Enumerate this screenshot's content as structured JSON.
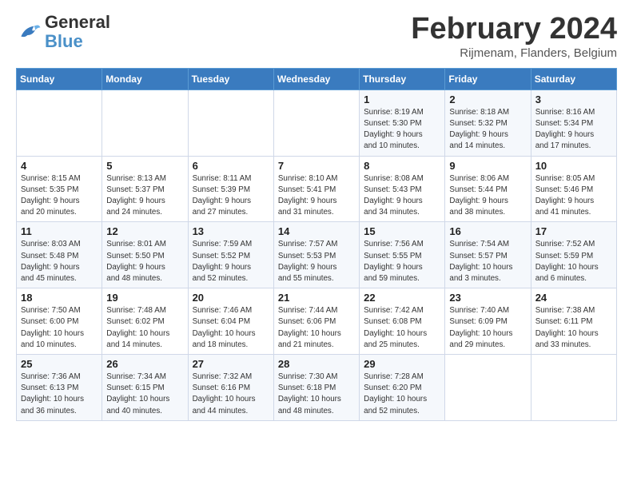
{
  "logo": {
    "line1": "General",
    "line2": "Blue"
  },
  "title": "February 2024",
  "subtitle": "Rijmenam, Flanders, Belgium",
  "days_header": [
    "Sunday",
    "Monday",
    "Tuesday",
    "Wednesday",
    "Thursday",
    "Friday",
    "Saturday"
  ],
  "weeks": [
    [
      {
        "day": "",
        "info": ""
      },
      {
        "day": "",
        "info": ""
      },
      {
        "day": "",
        "info": ""
      },
      {
        "day": "",
        "info": ""
      },
      {
        "day": "1",
        "info": "Sunrise: 8:19 AM\nSunset: 5:30 PM\nDaylight: 9 hours\nand 10 minutes."
      },
      {
        "day": "2",
        "info": "Sunrise: 8:18 AM\nSunset: 5:32 PM\nDaylight: 9 hours\nand 14 minutes."
      },
      {
        "day": "3",
        "info": "Sunrise: 8:16 AM\nSunset: 5:34 PM\nDaylight: 9 hours\nand 17 minutes."
      }
    ],
    [
      {
        "day": "4",
        "info": "Sunrise: 8:15 AM\nSunset: 5:35 PM\nDaylight: 9 hours\nand 20 minutes."
      },
      {
        "day": "5",
        "info": "Sunrise: 8:13 AM\nSunset: 5:37 PM\nDaylight: 9 hours\nand 24 minutes."
      },
      {
        "day": "6",
        "info": "Sunrise: 8:11 AM\nSunset: 5:39 PM\nDaylight: 9 hours\nand 27 minutes."
      },
      {
        "day": "7",
        "info": "Sunrise: 8:10 AM\nSunset: 5:41 PM\nDaylight: 9 hours\nand 31 minutes."
      },
      {
        "day": "8",
        "info": "Sunrise: 8:08 AM\nSunset: 5:43 PM\nDaylight: 9 hours\nand 34 minutes."
      },
      {
        "day": "9",
        "info": "Sunrise: 8:06 AM\nSunset: 5:44 PM\nDaylight: 9 hours\nand 38 minutes."
      },
      {
        "day": "10",
        "info": "Sunrise: 8:05 AM\nSunset: 5:46 PM\nDaylight: 9 hours\nand 41 minutes."
      }
    ],
    [
      {
        "day": "11",
        "info": "Sunrise: 8:03 AM\nSunset: 5:48 PM\nDaylight: 9 hours\nand 45 minutes."
      },
      {
        "day": "12",
        "info": "Sunrise: 8:01 AM\nSunset: 5:50 PM\nDaylight: 9 hours\nand 48 minutes."
      },
      {
        "day": "13",
        "info": "Sunrise: 7:59 AM\nSunset: 5:52 PM\nDaylight: 9 hours\nand 52 minutes."
      },
      {
        "day": "14",
        "info": "Sunrise: 7:57 AM\nSunset: 5:53 PM\nDaylight: 9 hours\nand 55 minutes."
      },
      {
        "day": "15",
        "info": "Sunrise: 7:56 AM\nSunset: 5:55 PM\nDaylight: 9 hours\nand 59 minutes."
      },
      {
        "day": "16",
        "info": "Sunrise: 7:54 AM\nSunset: 5:57 PM\nDaylight: 10 hours\nand 3 minutes."
      },
      {
        "day": "17",
        "info": "Sunrise: 7:52 AM\nSunset: 5:59 PM\nDaylight: 10 hours\nand 6 minutes."
      }
    ],
    [
      {
        "day": "18",
        "info": "Sunrise: 7:50 AM\nSunset: 6:00 PM\nDaylight: 10 hours\nand 10 minutes."
      },
      {
        "day": "19",
        "info": "Sunrise: 7:48 AM\nSunset: 6:02 PM\nDaylight: 10 hours\nand 14 minutes."
      },
      {
        "day": "20",
        "info": "Sunrise: 7:46 AM\nSunset: 6:04 PM\nDaylight: 10 hours\nand 18 minutes."
      },
      {
        "day": "21",
        "info": "Sunrise: 7:44 AM\nSunset: 6:06 PM\nDaylight: 10 hours\nand 21 minutes."
      },
      {
        "day": "22",
        "info": "Sunrise: 7:42 AM\nSunset: 6:08 PM\nDaylight: 10 hours\nand 25 minutes."
      },
      {
        "day": "23",
        "info": "Sunrise: 7:40 AM\nSunset: 6:09 PM\nDaylight: 10 hours\nand 29 minutes."
      },
      {
        "day": "24",
        "info": "Sunrise: 7:38 AM\nSunset: 6:11 PM\nDaylight: 10 hours\nand 33 minutes."
      }
    ],
    [
      {
        "day": "25",
        "info": "Sunrise: 7:36 AM\nSunset: 6:13 PM\nDaylight: 10 hours\nand 36 minutes."
      },
      {
        "day": "26",
        "info": "Sunrise: 7:34 AM\nSunset: 6:15 PM\nDaylight: 10 hours\nand 40 minutes."
      },
      {
        "day": "27",
        "info": "Sunrise: 7:32 AM\nSunset: 6:16 PM\nDaylight: 10 hours\nand 44 minutes."
      },
      {
        "day": "28",
        "info": "Sunrise: 7:30 AM\nSunset: 6:18 PM\nDaylight: 10 hours\nand 48 minutes."
      },
      {
        "day": "29",
        "info": "Sunrise: 7:28 AM\nSunset: 6:20 PM\nDaylight: 10 hours\nand 52 minutes."
      },
      {
        "day": "",
        "info": ""
      },
      {
        "day": "",
        "info": ""
      }
    ]
  ]
}
